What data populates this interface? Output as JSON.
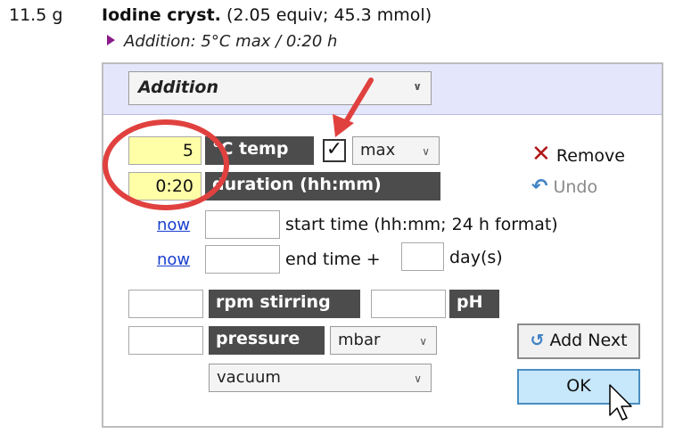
{
  "header": {
    "amount": "11.5 g",
    "reagent_name": "Iodine cryst.",
    "reagent_detail": "(2.05 equiv; 45.3 mmol)",
    "step_summary": "Addition: 5°C max / 0:20 h"
  },
  "panel": {
    "step_type": "Addition",
    "temp_value": "5",
    "temp_label": "°C temp",
    "max_checked": true,
    "max_option": "max",
    "duration_value": "0:20",
    "duration_label": "duration (hh:mm)",
    "now_link_1": "now",
    "start_time_value": "",
    "start_time_label": "start time (hh:mm; 24 h format)",
    "now_link_2": "now",
    "end_time_value": "",
    "end_time_label": "end time +",
    "days_value": "",
    "days_label": "day(s)",
    "rpm_value": "",
    "rpm_label": "rpm stirring",
    "ph_value": "",
    "ph_label": "pH",
    "pressure_value": "",
    "pressure_label": "pressure",
    "pressure_unit": "mbar",
    "vacuum_option": "vacuum",
    "remove_label": "Remove",
    "undo_label": "Undo",
    "add_next_label": "Add Next",
    "ok_label": "OK"
  },
  "colors": {
    "panel_header": "#e4e6fb",
    "highlight_input": "#ffffa8",
    "dark_label": "#4c4c4c",
    "ok_button": "#c7e7fb",
    "annotation": "#e0413f"
  }
}
